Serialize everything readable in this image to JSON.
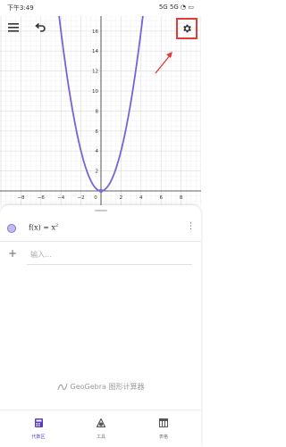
{
  "status": {
    "time": "下午3:49",
    "indicators": "5G  5G  ◔  ▭"
  },
  "graph": {
    "x_ticks": [
      "−8",
      "−6",
      "−4",
      "−2",
      "0",
      "2",
      "4",
      "6",
      "8"
    ],
    "y_ticks": [
      "2",
      "4",
      "6",
      "8",
      "10",
      "12",
      "14",
      "16"
    ],
    "function": "f(x) = x²",
    "curve_color": "#7b61d6"
  },
  "toolbar": {
    "menu_icon": "menu-icon",
    "undo_icon": "undo-icon",
    "settings_icon": "gear-icon"
  },
  "algebra": {
    "expression_prefix": "f(x) = x",
    "expression_exponent": "2",
    "input_placeholder": "输入..."
  },
  "branding": {
    "text": "GeoGebra 图形计算器"
  },
  "nav": [
    {
      "label": "代数区",
      "icon": "calculator-icon"
    },
    {
      "label": "工具",
      "icon": "tools-icon"
    },
    {
      "label": "表格",
      "icon": "table-icon"
    }
  ],
  "colors": {
    "accent": "#5b3cc4",
    "highlight": "#e53935",
    "dot_fill": "#c6b9ee"
  }
}
